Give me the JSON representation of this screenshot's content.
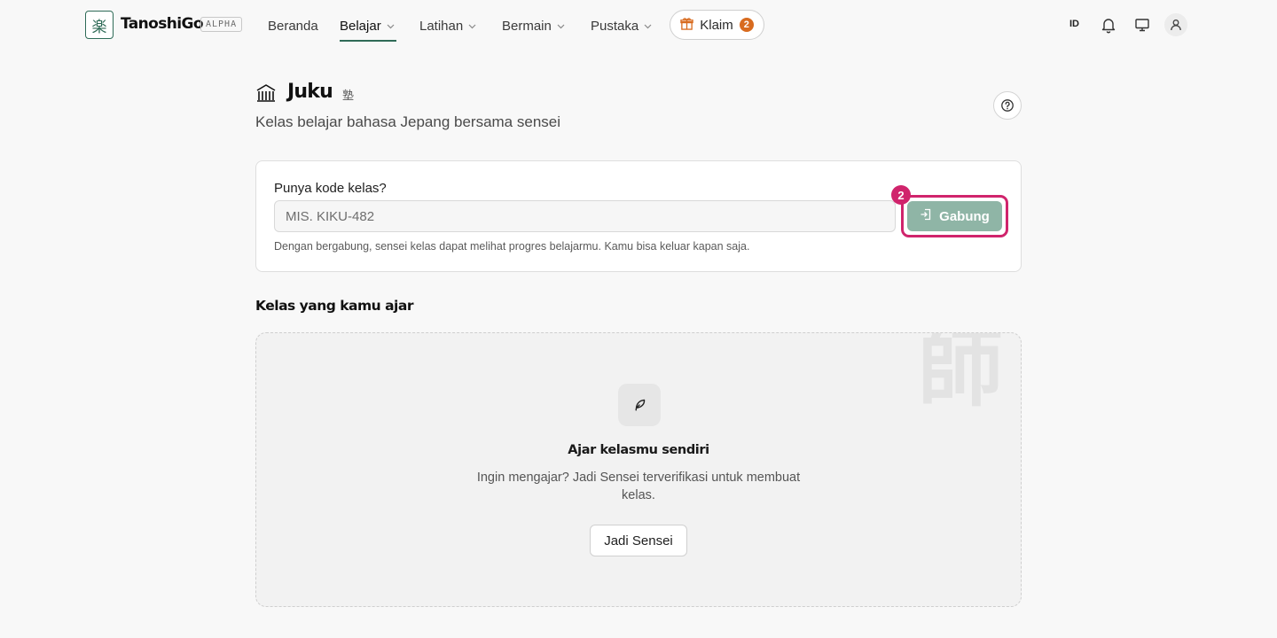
{
  "nav": {
    "logo_glyph": "楽",
    "brand": "TanoshiGo",
    "badge": "ALPHA",
    "items": [
      {
        "label": "Beranda",
        "has_menu": false,
        "active": false
      },
      {
        "label": "Belajar",
        "has_menu": true,
        "active": true
      },
      {
        "label": "Latihan",
        "has_menu": true,
        "active": false
      },
      {
        "label": "Bermain",
        "has_menu": true,
        "active": false
      },
      {
        "label": "Pustaka",
        "has_menu": true,
        "active": false
      }
    ],
    "claim": {
      "label": "Klaim",
      "count": "2",
      "icon": "gift-icon"
    },
    "language": "ID",
    "icons": [
      "bell-icon",
      "monitor-icon",
      "user-icon"
    ],
    "accent_color": "#2f6b57"
  },
  "header": {
    "icon": "school-building-icon",
    "title": "Juku",
    "kanji": "塾",
    "subtitle": "Kelas belajar bahasa Jepang bersama sensei",
    "help_icon": "question-circle-icon"
  },
  "join": {
    "label": "Punya kode kelas?",
    "input_value": "",
    "input_placeholder": "MIS. KIKU-482",
    "button_label": "Gabung",
    "button_icon": "sign-in-icon",
    "hint": "Dengan bergabung, sensei kelas dapat melihat progres belajarmu. Kamu bisa keluar kapan saja.",
    "step_marker": "2",
    "highlight_color": "#d0246c",
    "button_color": "#8fb5a6"
  },
  "teaching": {
    "section_title": "Kelas yang kamu ajar",
    "watermark_kanji": "師",
    "empty_icon": "feather-icon",
    "empty_title": "Ajar kelasmu sendiri",
    "empty_description": "Ingin mengajar? Jadi Sensei terverifikasi untuk membuat kelas.",
    "cta_label": "Jadi Sensei"
  }
}
